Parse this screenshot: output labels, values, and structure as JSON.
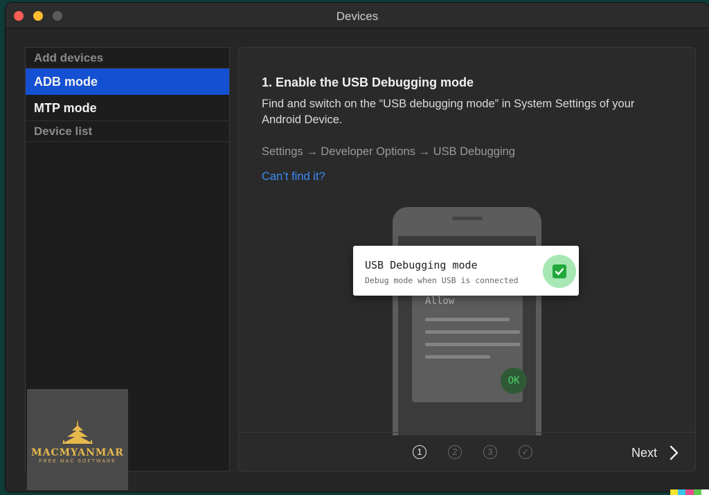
{
  "window": {
    "title": "Devices"
  },
  "sidebar": {
    "sections": [
      {
        "label": "Add devices"
      },
      {
        "label": "Device list"
      }
    ],
    "items": [
      {
        "label": "ADB mode",
        "active": true
      },
      {
        "label": "MTP mode",
        "active": false
      }
    ]
  },
  "main": {
    "step_title": "1. Enable the USB Debugging mode",
    "description": "Find and switch on the “USB debugging mode” in System Settings of your Android Device.",
    "path": "Settings → Developer Options → USB Debugging",
    "help_link": "Can’t find it?",
    "illustration": {
      "card_title": "USB Debugging mode",
      "card_subtitle": "Debug mode when USB is connected",
      "dialog_label": "Allow",
      "ok_label": "OK"
    },
    "steps": [
      "1",
      "2",
      "3",
      "✓"
    ],
    "current_step": 1,
    "next_label": "Next"
  },
  "watermark": {
    "name": "MACMYANMAR",
    "tagline": "FREE MAC SOFTWARE"
  },
  "colors": {
    "accent": "#1450d2",
    "link": "#3b8cf6",
    "success": "#21a83a"
  }
}
